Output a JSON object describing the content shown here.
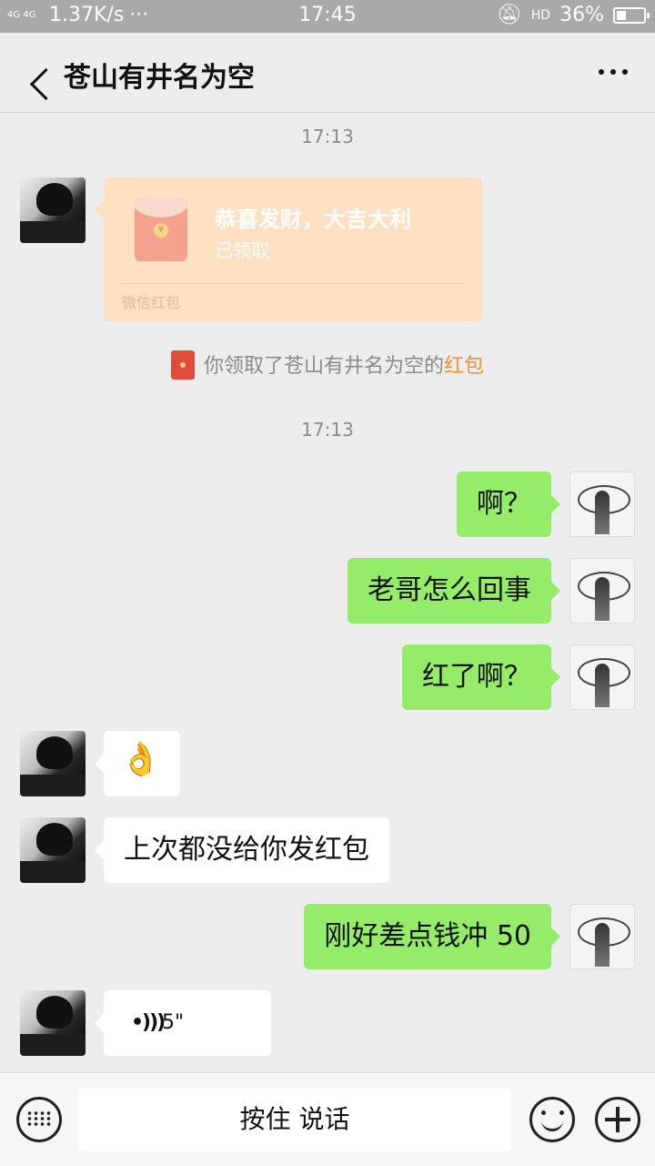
{
  "status_bar": {
    "network": "4G 4G",
    "speed": "1.37K/s",
    "dots": "···",
    "time": "17:45",
    "hd": "HD",
    "battery": "36%",
    "battery_level": 0.36
  },
  "header": {
    "title": "苍山有井名为空"
  },
  "chat": {
    "timestamp_1": "17:13",
    "red_packet": {
      "title": "恭喜发财，大吉大利",
      "status": "已领取",
      "coin": "¥",
      "footer": "微信红包"
    },
    "system_notice": {
      "text": "你领取了苍山有井名为空的",
      "link": "红包"
    },
    "timestamp_2": "17:13",
    "messages": [
      {
        "side": "out",
        "text": "啊？"
      },
      {
        "side": "out",
        "text": "老哥怎么回事"
      },
      {
        "side": "out",
        "text": "红了啊？"
      },
      {
        "side": "in",
        "text": "👌"
      },
      {
        "side": "in",
        "text": "上次都没给你发红包"
      },
      {
        "side": "out",
        "text": "刚好差点钱冲 50"
      },
      {
        "side": "in",
        "text": "5\""
      }
    ]
  },
  "input_bar": {
    "press_to_talk": "按住 说话"
  },
  "colors": {
    "out_bubble": "#95ec69",
    "in_bubble": "#ffffff",
    "red_packet": "#fde1c2",
    "link": "#f0902a"
  }
}
